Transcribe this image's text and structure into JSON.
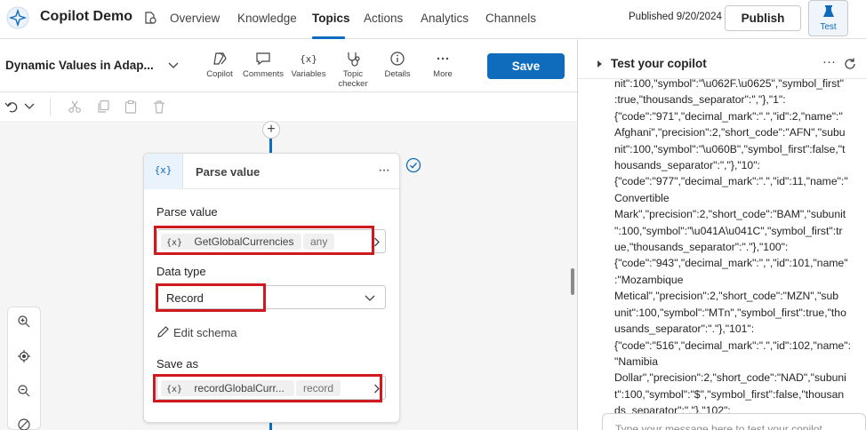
{
  "app": {
    "title": "Copilot Demo"
  },
  "nav": {
    "tabs": [
      {
        "label": "Overview"
      },
      {
        "label": "Knowledge"
      },
      {
        "label": "Topics"
      },
      {
        "label": "Actions"
      },
      {
        "label": "Analytics"
      },
      {
        "label": "Channels"
      }
    ],
    "active_tab": "Topics"
  },
  "header": {
    "published": "Published 9/20/2024",
    "publish_label": "Publish",
    "test_label": "Test"
  },
  "toolbar": {
    "topic_name": "Dynamic Values in Adap...",
    "tools": [
      {
        "label": "Copilot",
        "icon": "copilot-icon"
      },
      {
        "label": "Comments",
        "icon": "comment-icon"
      },
      {
        "label": "Variables",
        "icon": "variables-icon"
      },
      {
        "label": "Topic checker",
        "icon": "stethoscope-icon"
      },
      {
        "label": "Details",
        "icon": "info-icon"
      },
      {
        "label": "More",
        "icon": "more-icon"
      }
    ],
    "save_label": "Save"
  },
  "node": {
    "icon_text": "{x}",
    "title": "Parse value",
    "parse_label": "Parse value",
    "parse_var_icon": "{x}",
    "parse_var": "GetGlobalCurrencies",
    "parse_type": "any",
    "data_type_label": "Data type",
    "data_type_value": "Record",
    "edit_schema": "Edit schema",
    "save_as_label": "Save as",
    "save_var_icon": "{x}",
    "save_var": "recordGlobalCurr...",
    "save_type": "record"
  },
  "test_panel": {
    "title": "Test your copilot",
    "output_lines": [
      "nit\":100,\"symbol\":\"\\u062F.\\u0625\",\"symbol_first\"",
      ":true,\"thousands_separator\":\",\"},\"1\":",
      "{\"code\":\"971\",\"decimal_mark\":\".\",\"id\":2,\"name\":\"",
      "Afghani\",\"precision\":2,\"short_code\":\"AFN\",\"subu",
      "nit\":100,\"symbol\":\"\\u060B\",\"symbol_first\":false,\"t",
      "housands_separator\":\",\"},\"10\":",
      "{\"code\":\"977\",\"decimal_mark\":\".\",\"id\":11,\"name\":\"",
      "Convertible",
      "Mark\",\"precision\":2,\"short_code\":\"BAM\",\"subunit",
      "\":100,\"symbol\":\"\\u041A\\u041C\",\"symbol_first\":tr",
      "ue,\"thousands_separator\":\".\"},\"100\":",
      "{\"code\":\"943\",\"decimal_mark\":\",\",\"id\":101,\"name\"",
      ":\"Mozambique",
      "Metical\",\"precision\":2,\"short_code\":\"MZN\",\"sub",
      "unit\":100,\"symbol\":\"MTn\",\"symbol_first\":true,\"tho",
      "usands_separator\":\".\"},\"101\":",
      "{\"code\":\"516\",\"decimal_mark\":\".\",\"id\":102,\"name\":",
      "\"Namibia",
      "Dollar\",\"precision\":2,\"short_code\":\"NAD\",\"subuni",
      "t\":100,\"symbol\":\"$\",\"symbol_first\":false,\"thousan",
      "ds_separator\":\",\"},\"102\":"
    ],
    "input_placeholder": "Type your message here to test your copilot"
  },
  "colors": {
    "accent": "#0f6cbd",
    "highlight": "#d0191e"
  }
}
